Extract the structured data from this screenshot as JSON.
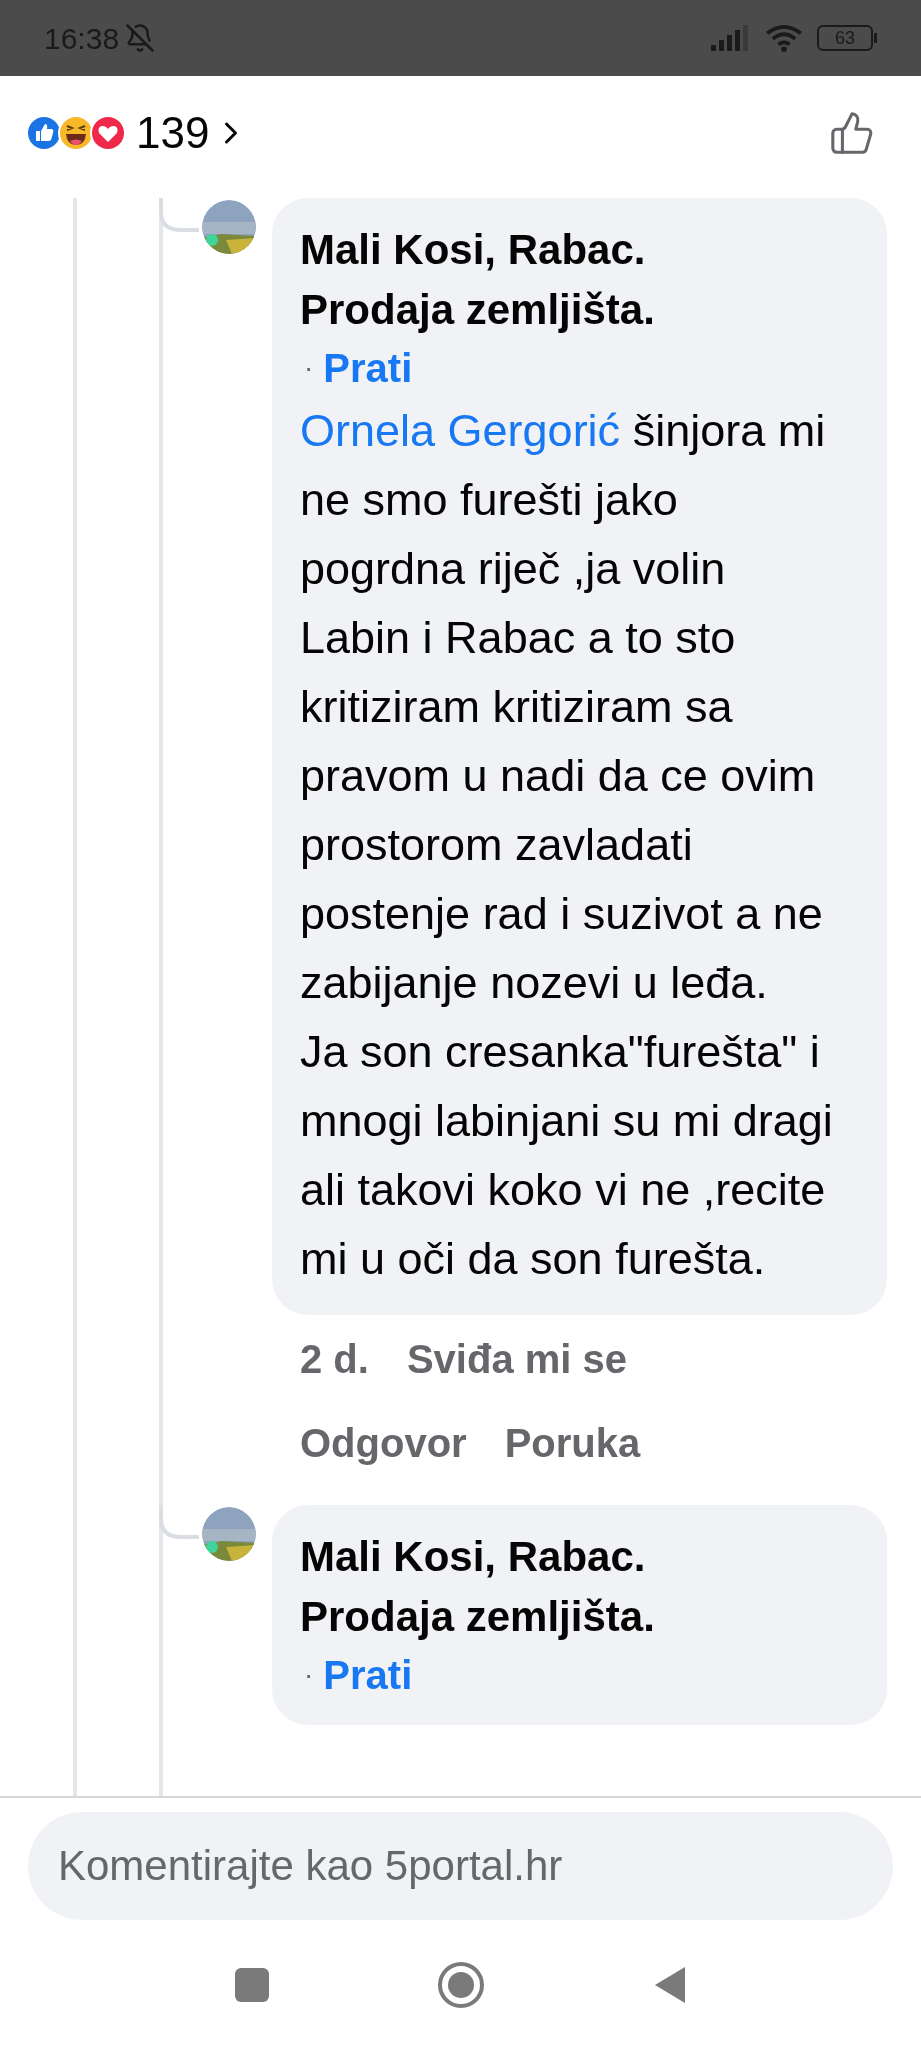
{
  "status_bar": {
    "time": "16:38",
    "battery": "63"
  },
  "reactions": {
    "count": "139"
  },
  "comments": [
    {
      "author": "Mali Kosi, Rabac. Prodaja zemljišta.",
      "separator": "·",
      "follow": "Prati",
      "mention": "Ornela Gergorić",
      "text": " šinjora mi ne smo furešti jako pogrdna riječ ,ja volin Labin i Rabac a to sto kritiziram kritiziram sa pravom u nadi da ce ovim prostorom zavladati postenje rad i suzivot a ne zabijanje nozevi u leđa.\nJa son cresanka\"furešta\" i mnogi labinjani su mi dragi ali takovi koko vi ne ,recite mi u oči da son furešta.",
      "time": "2 d.",
      "actions": [
        "Sviđa mi se",
        "Odgovor",
        "Poruka"
      ]
    },
    {
      "author": "Mali Kosi, Rabac. Prodaja zemljišta.",
      "separator": "·",
      "follow": "Prati"
    }
  ],
  "composer": {
    "placeholder": "Komentirajte kao 5portal.hr"
  }
}
